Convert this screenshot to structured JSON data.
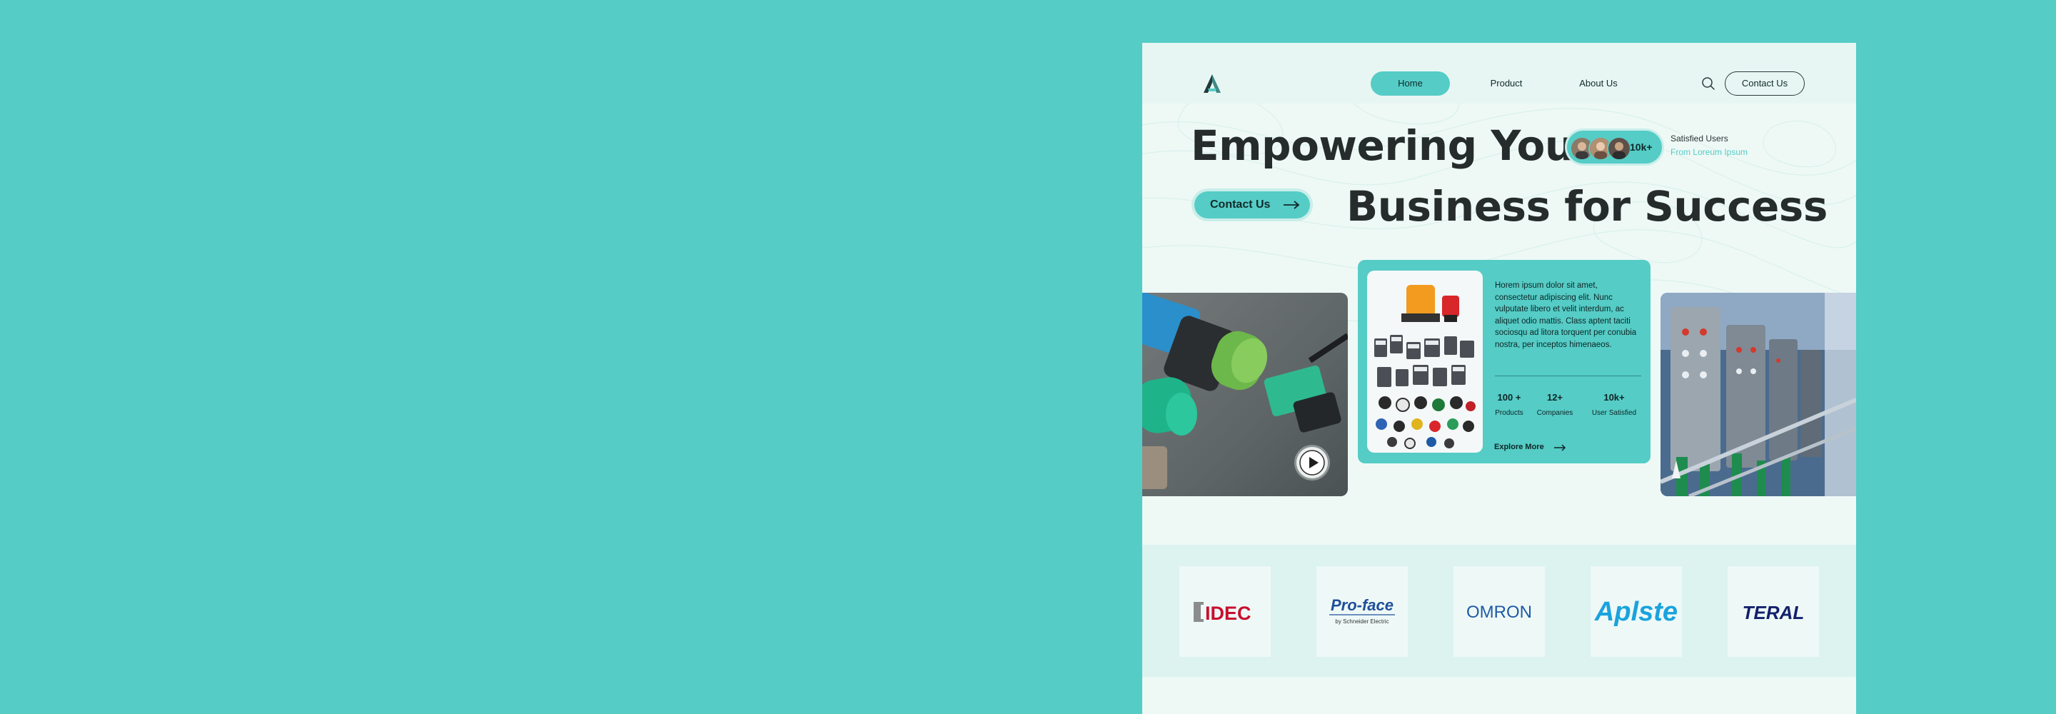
{
  "nav": {
    "items": [
      {
        "label": "Home",
        "active": true
      },
      {
        "label": "Product"
      },
      {
        "label": "About Us"
      }
    ],
    "contact_label": "Contact Us",
    "icons": {
      "logo": "brand-logo-icon",
      "search": "search-icon"
    }
  },
  "hero": {
    "line1": "Empowering Your",
    "line2": "Business for Success",
    "cta_label": "Contact Us",
    "users": {
      "count": "10k+",
      "title": "Satisfied Users",
      "subtitle": "From Loreum Ipsum"
    }
  },
  "feature_card": {
    "description": "Horem ipsum dolor sit amet, consectetur adipiscing elit. Nunc vulputate libero et velit interdum, ac aliquet odio mattis. Class aptent taciti sociosqu ad litora torquent per conubia nostra, per inceptos himenaeos.",
    "stats": [
      {
        "value": "100 +",
        "label": "Products"
      },
      {
        "value": "12+",
        "label": "Companies"
      },
      {
        "value": "10k+",
        "label": "User Satisfied"
      }
    ],
    "explore_label": "Explore More"
  },
  "partners": {
    "logos": [
      "IDEC",
      "Pro-face",
      "OMRON",
      "Aplste",
      "TERAL"
    ],
    "proface_sub": "by Schneider Electric"
  },
  "colors": {
    "background": "#55CCC6",
    "accent": "#55CCC6",
    "page": "#EEF9F6",
    "text_dark": "#262C2C",
    "idec_red": "#C8102E",
    "proface_blue": "#1F4E9A",
    "omron_blue": "#1F5AA6",
    "aplste_blue": "#1AA3DE",
    "teral_navy": "#13206B"
  }
}
